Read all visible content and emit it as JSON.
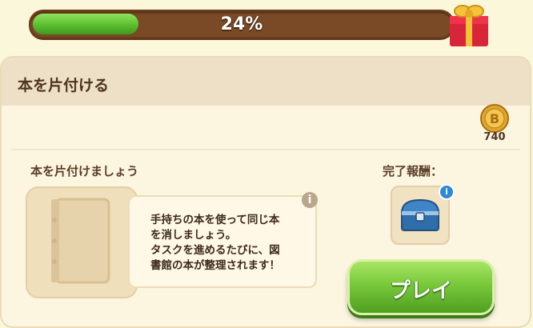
{
  "progress": {
    "percent_label": "24%",
    "fraction": 0.24
  },
  "gift": {
    "icon": "gift-icon"
  },
  "panel": {
    "title": "本を片付ける",
    "coin": {
      "icon": "coin-icon",
      "count": "740"
    },
    "task_label": "本を片付けましょう",
    "reward_label": "完了報酬：",
    "description_lines": [
      "手持ちの本を使って同じ本",
      "を消しましょう。",
      "タスクを進めるたびに、図",
      "書館の本が整理されます！"
    ],
    "task_icon": "book-icon",
    "reward_icon": "treasure-chest-icon",
    "info_icon": "info-icon",
    "play_label": "プレイ"
  },
  "colors": {
    "progress_fill": "#5cbd2f",
    "progress_track": "#7a4a26",
    "play_button": "#79c83a",
    "panel_bg": "#fcf5df",
    "header_bg": "#ede0c6"
  }
}
